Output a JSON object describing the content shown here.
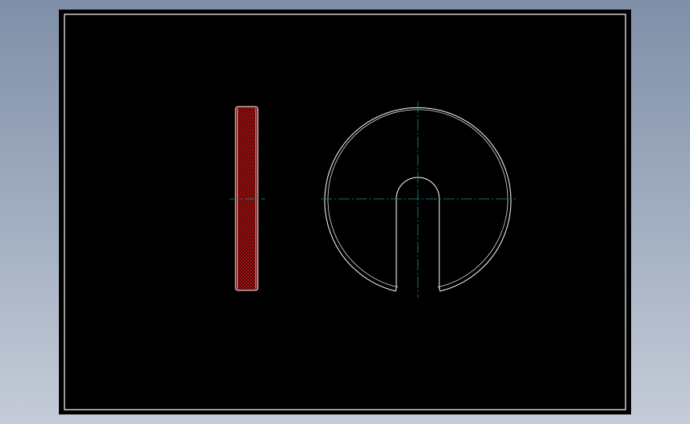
{
  "colors": {
    "background_top": "#7f8fa8",
    "background_bottom": "#c5ccd8",
    "sheet": "#000000",
    "outline": "#ffffff",
    "centerline": "#00a0a0",
    "hatch": "#cc1111",
    "hatch_fill": "#3a0808"
  },
  "views": {
    "side_view": "section-view-hatched",
    "front_view": "slotted-disc"
  }
}
